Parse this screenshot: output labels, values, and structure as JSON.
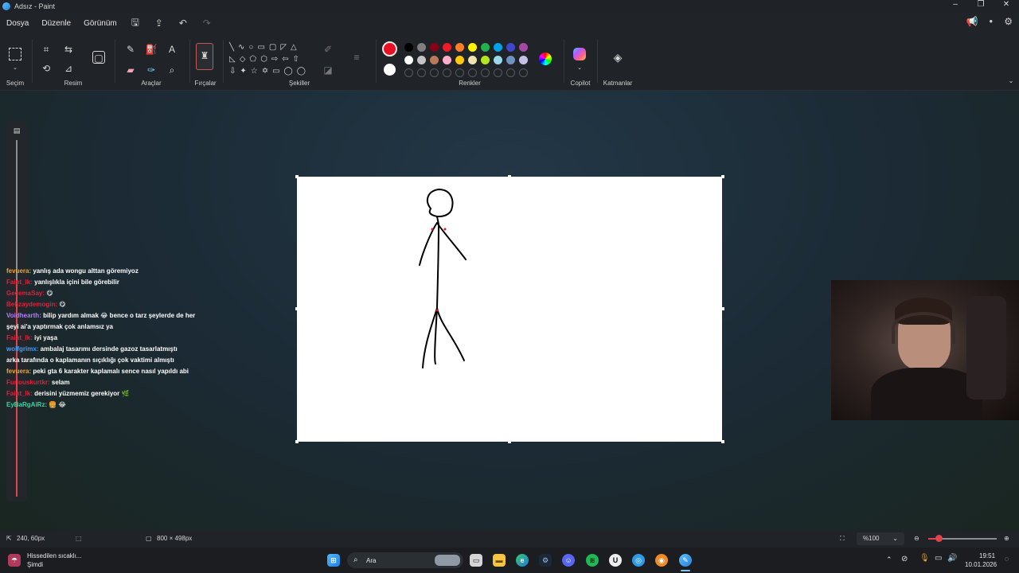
{
  "window": {
    "title": "Adsız - Paint",
    "controls": [
      "–",
      "❐",
      "✕"
    ]
  },
  "menu": {
    "items": [
      "Dosya",
      "Düzenle",
      "Görünüm"
    ]
  },
  "ribbon": {
    "groups": {
      "selection": "Seçim",
      "image": "Resim",
      "tools": "Araçlar",
      "brushes": "Fırçalar",
      "shapes": "Şekiller",
      "colors": "Renkler",
      "copilot": "Copilot",
      "layers": "Katmanlar"
    },
    "primary_color": "#e81123",
    "secondary_color": "#ffffff",
    "palette_row1": [
      "#000000",
      "#7f7f7f",
      "#880015",
      "#ed1c24",
      "#ff7f27",
      "#fff200",
      "#22b14c",
      "#00a2e8",
      "#3f48cc",
      "#a349a4"
    ],
    "palette_row2": [
      "#ffffff",
      "#c3c3c3",
      "#b97a57",
      "#ffaec9",
      "#ffc90e",
      "#efe4b0",
      "#b5e61d",
      "#99d9ea",
      "#7092be",
      "#c8bfe7"
    ]
  },
  "chat": [
    {
      "user": "fevuera:",
      "user_color": "#f5a623",
      "text": "yanlış ada wongu alttan göremiyoz"
    },
    {
      "user": "Faint_lk:",
      "user_color": "#e0203a",
      "text": "yanlışlıkla içini bile görebilir"
    },
    {
      "user": "GecemaSay:",
      "user_color": "#e0203a",
      "text": "😋"
    },
    {
      "user": "Behzaydemogin:",
      "user_color": "#e0203a",
      "text": "😋"
    },
    {
      "user": "Voidhearth:",
      "user_color": "#b07cff",
      "text": "bilip yardım almak 😂 bence o tarz şeylerde de her"
    },
    {
      "user": "",
      "user_color": "#ffffff",
      "text": "şeyi ai'a yaptırmak çok anlamsız ya"
    },
    {
      "user": "Faint_lk:",
      "user_color": "#e0203a",
      "text": "iyi yaşa"
    },
    {
      "user": "wolfgrimx:",
      "user_color": "#3aa0ff",
      "text": "ambalaj tasarımı dersinde gazoz tasarlatmıştı"
    },
    {
      "user": "",
      "user_color": "#ffffff",
      "text": "arka tarafında o kaplamanın sıçıklığı çok vaktimi almıştı"
    },
    {
      "user": "fevuera:",
      "user_color": "#f5a623",
      "text": "peki gta 6 karakter kaplamalı sence nasıl yapıldı abi"
    },
    {
      "user": "Furiouskurtkr:",
      "user_color": "#e0203a",
      "text": "selam"
    },
    {
      "user": "Faint_lk:",
      "user_color": "#e0203a",
      "text": "derisini yüzmemiz gerekiyor 🌿"
    },
    {
      "user": "EyBaRgAiRz:",
      "user_color": "#2fd8a8",
      "text": "🍔 😂"
    }
  ],
  "status": {
    "cursor": "240, 60px",
    "canvas_size": "800 × 498px",
    "zoom": "%100"
  },
  "taskbar": {
    "weather": "Hissedilen sıcaklı...",
    "weather_sub": "Şimdi",
    "search_placeholder": "Ara",
    "time": "19:51",
    "date": "10.01.2026"
  }
}
